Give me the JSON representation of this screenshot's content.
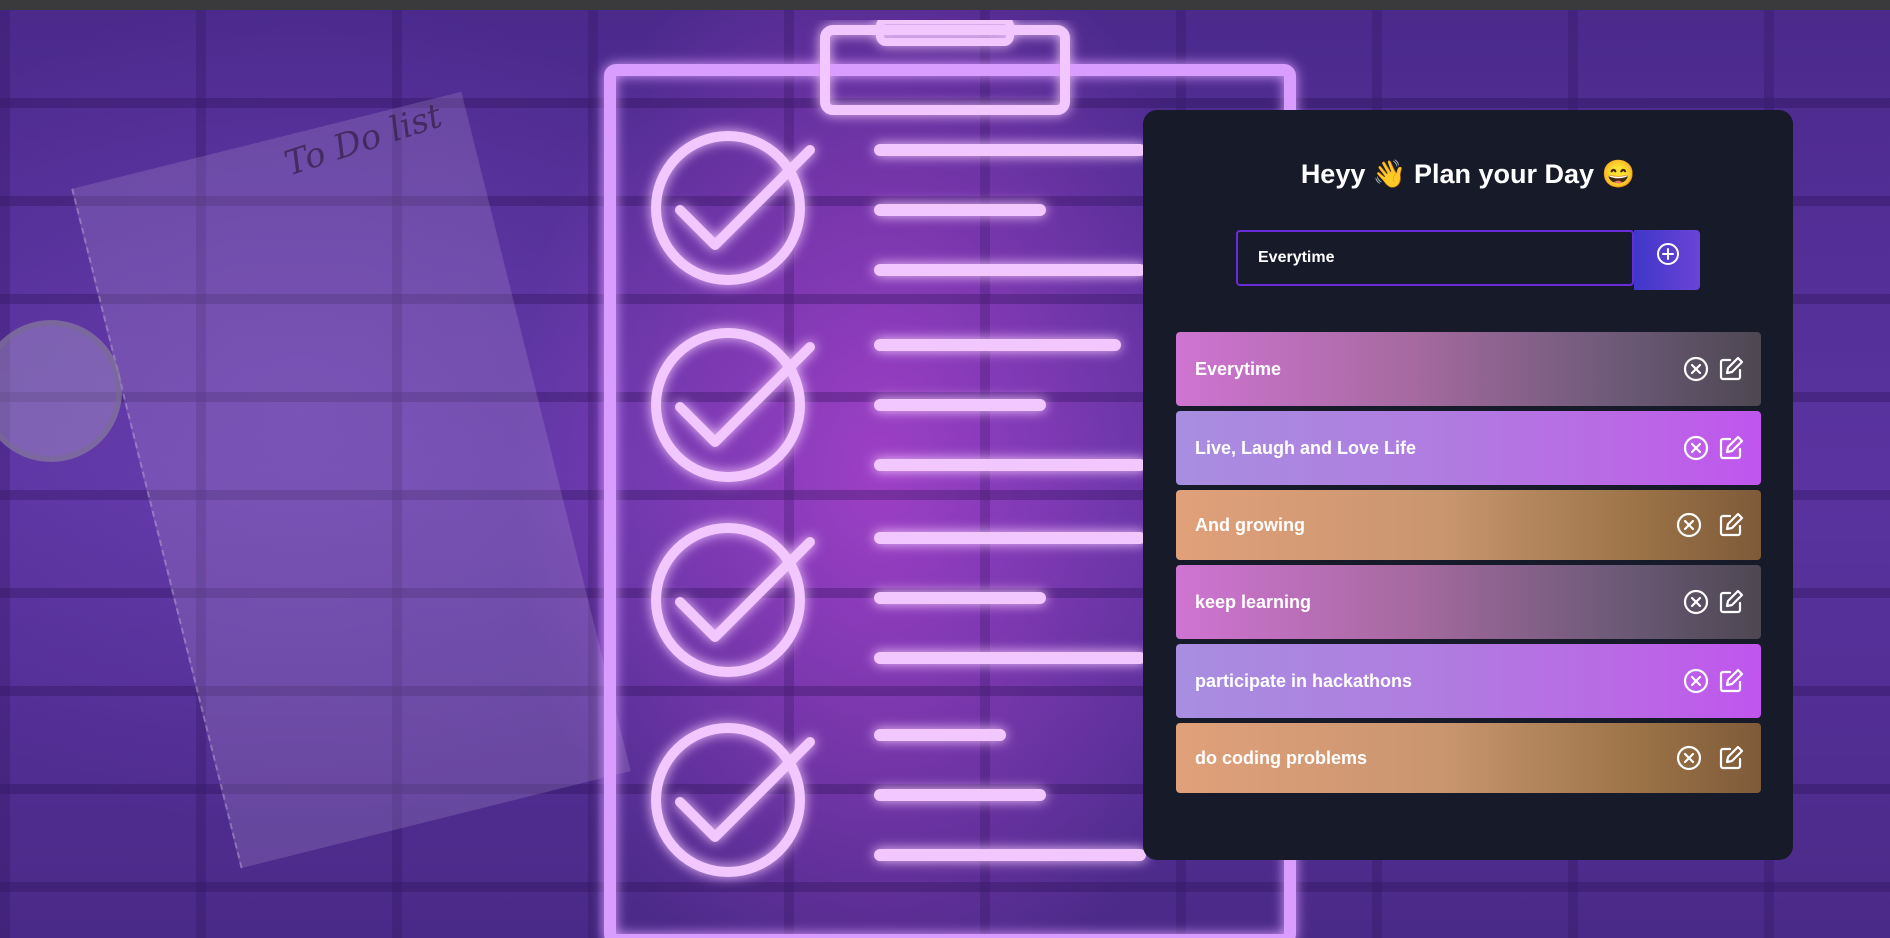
{
  "background": {
    "note_text": "To Do list"
  },
  "app": {
    "title": "Heyy 👋 Plan your Day 😄",
    "input": {
      "value": "Everytime",
      "placeholder": ""
    },
    "add_icon": "plus-circle-icon"
  },
  "tasks": [
    {
      "text": "Everytime",
      "style": "pink"
    },
    {
      "text": "Live, Laugh and Love Life",
      "style": "violet"
    },
    {
      "text": "And growing",
      "style": "orange"
    },
    {
      "text": "keep learning",
      "style": "pink"
    },
    {
      "text": "participate in hackathons",
      "style": "violet"
    },
    {
      "text": "do coding problems",
      "style": "orange"
    }
  ],
  "colors": {
    "card": "#171a28",
    "accent": "#6a2bd9",
    "pink": "#cf74d2",
    "violet": "#b07ce0",
    "orange": "#e0a07a"
  }
}
